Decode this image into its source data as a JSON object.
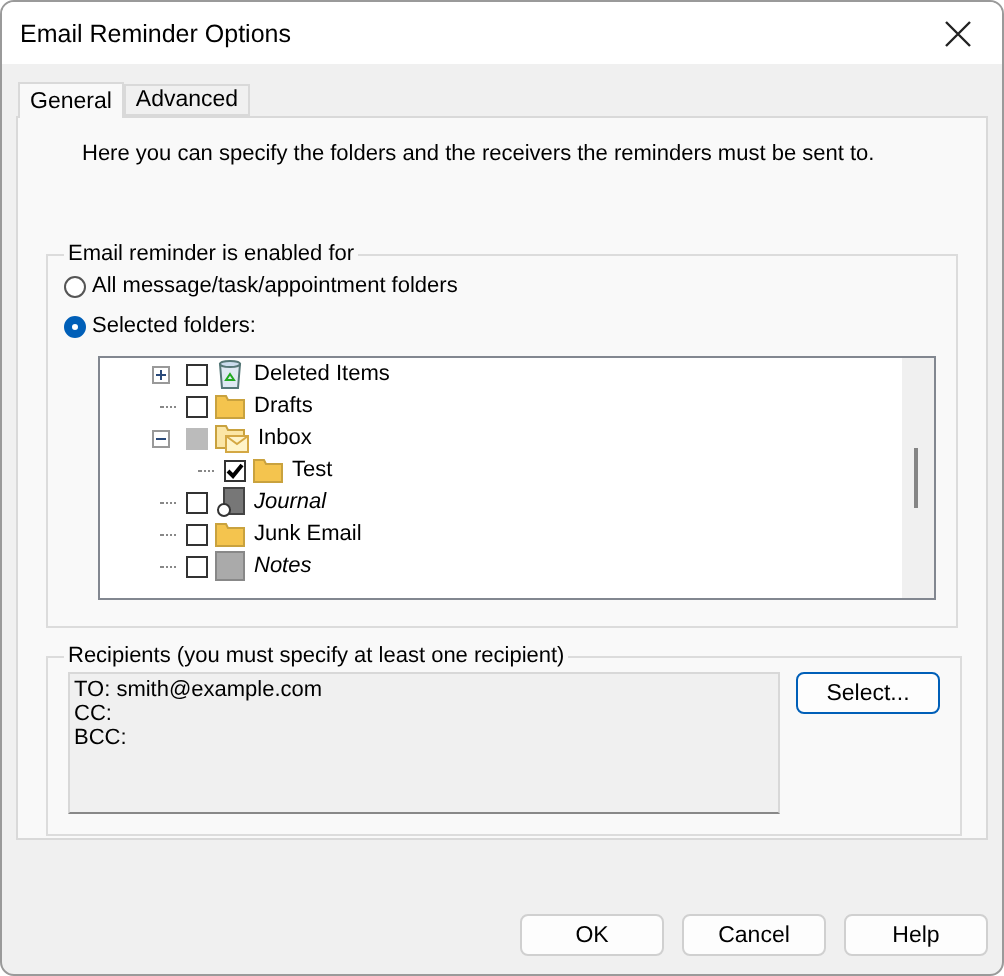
{
  "window": {
    "title": "Email Reminder Options"
  },
  "tabs": [
    {
      "label": "General",
      "selected": true
    },
    {
      "label": "Advanced",
      "selected": false
    }
  ],
  "intro": "Here you can specify the folders and the receivers the reminders must be sent to.",
  "scope_group": {
    "title": "Email reminder is enabled for",
    "options": [
      {
        "label": "All message/task/appointment folders",
        "selected": false
      },
      {
        "label": "Selected folders:",
        "selected": true
      }
    ],
    "folders": [
      {
        "label": "Deleted Items",
        "kind": "trash",
        "checked": false,
        "partial": false,
        "italic": false,
        "expanded": false
      },
      {
        "label": "Drafts",
        "kind": "folder",
        "checked": false,
        "partial": false,
        "italic": false
      },
      {
        "label": "Inbox",
        "kind": "mail",
        "checked": false,
        "partial": true,
        "italic": false,
        "expanded": true,
        "children": [
          {
            "label": "Test",
            "kind": "folder",
            "checked": true,
            "partial": false,
            "italic": false
          }
        ]
      },
      {
        "label": "Journal",
        "kind": "journal",
        "checked": false,
        "partial": false,
        "italic": true
      },
      {
        "label": "Junk Email",
        "kind": "folder",
        "checked": false,
        "partial": false,
        "italic": false
      },
      {
        "label": "Notes",
        "kind": "notes",
        "checked": false,
        "partial": false,
        "italic": true
      }
    ]
  },
  "recipients_group": {
    "title": "Recipients (you must specify at least one recipient)",
    "lines": [
      "TO: smith@example.com",
      "CC:",
      "BCC:"
    ],
    "button": "Select..."
  },
  "buttons": [
    "OK",
    "Cancel",
    "Help"
  ]
}
